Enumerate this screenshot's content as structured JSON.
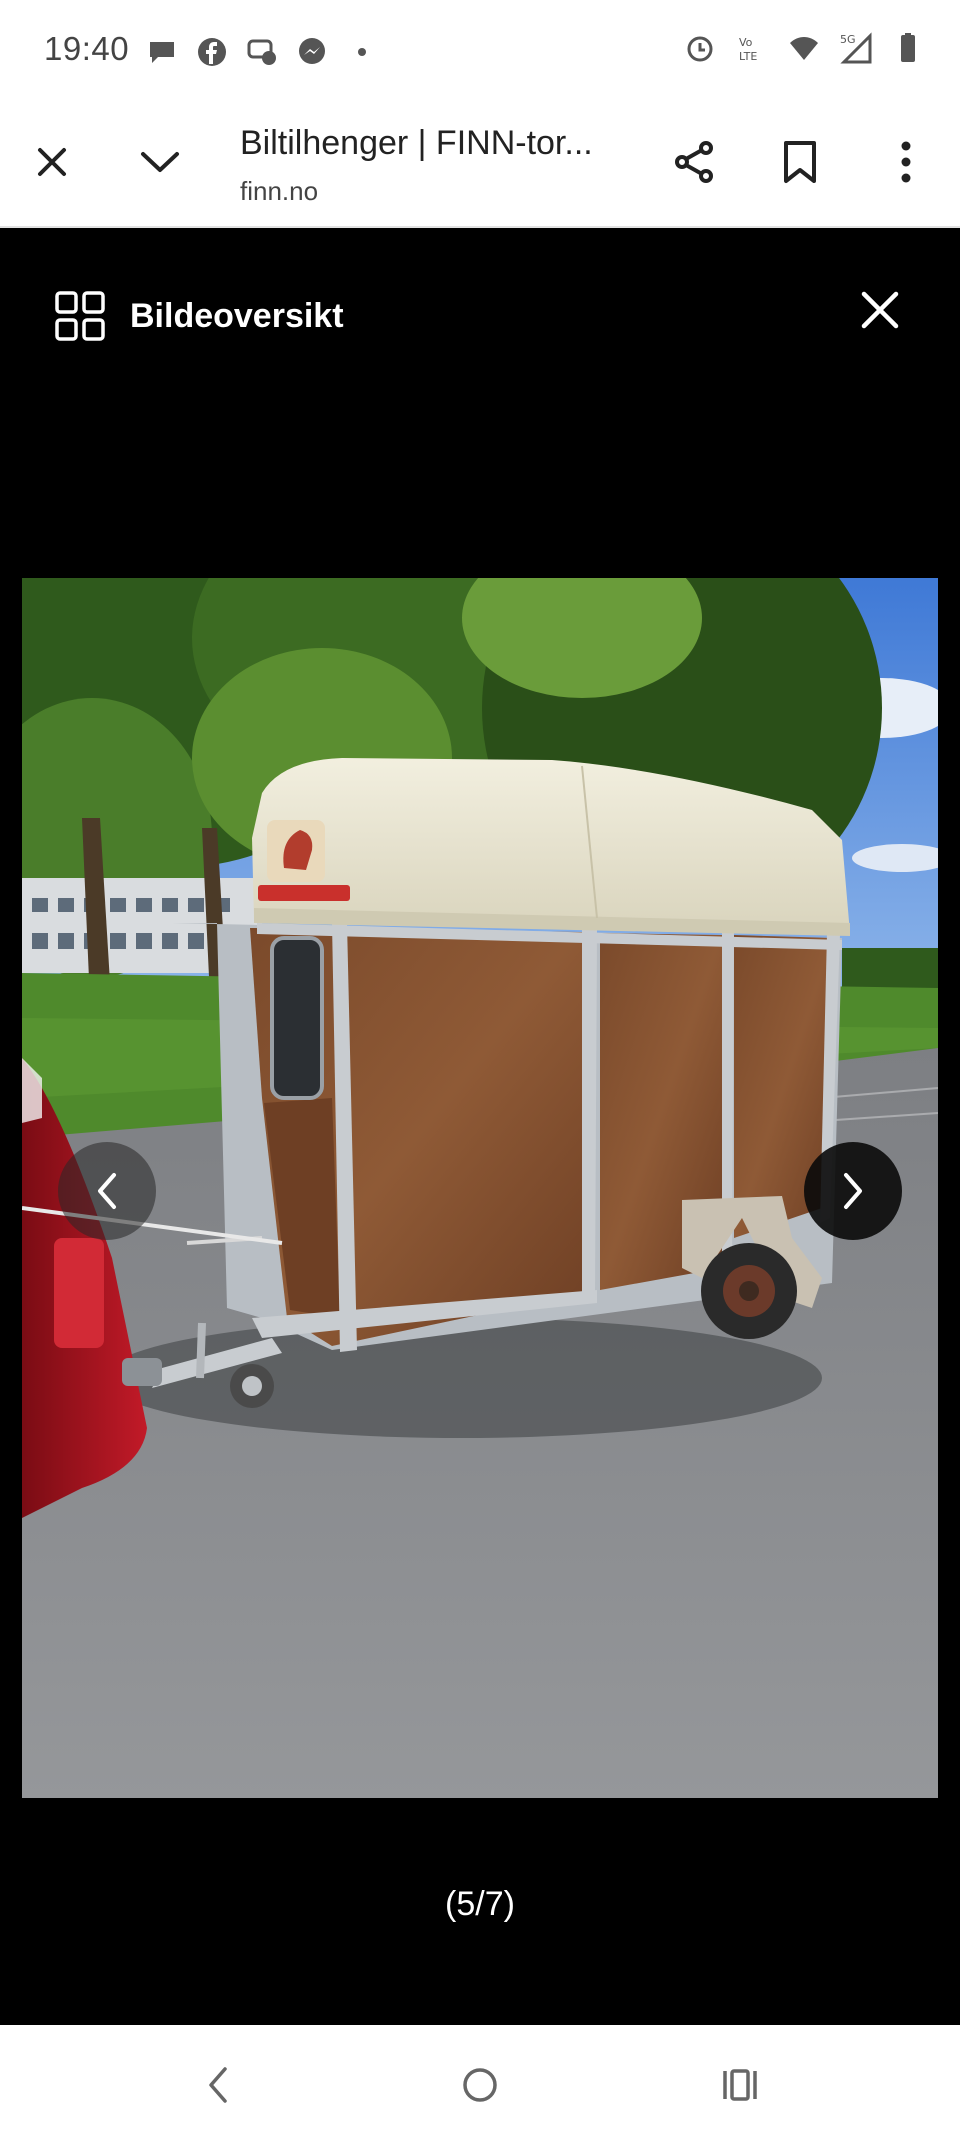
{
  "status_bar": {
    "time": "19:40",
    "left_icons": [
      "chat-bubble-icon",
      "facebook-icon",
      "messenger-group-icon",
      "messenger-icon",
      "dot-icon"
    ],
    "right_icons": [
      "alarm-icon",
      "volte-icon",
      "wifi-icon",
      "signal-5g-icon",
      "battery-icon"
    ]
  },
  "toolbar": {
    "title": "Biltilhenger | FINN-tor...",
    "url": "finn.no",
    "close_icon": "close-icon",
    "minimize_icon": "chevron-down-icon",
    "share_icon": "share-icon",
    "bookmark_icon": "bookmark-icon",
    "menu_icon": "more-vertical-icon"
  },
  "gallery": {
    "overview_label": "Bildeoversikt",
    "counter": "(5/7)",
    "current_index": 5,
    "total": 7,
    "colors": {
      "background": "#000000",
      "text": "#ffffff"
    }
  },
  "system_nav": {
    "back": "back-icon",
    "home": "home-icon",
    "recents": "recents-icon"
  }
}
